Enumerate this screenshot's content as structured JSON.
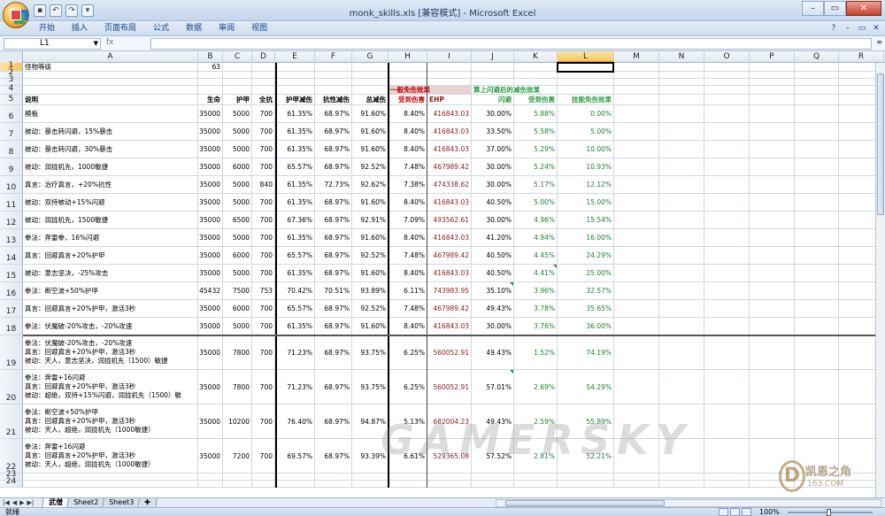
{
  "window": {
    "title": "monk_skills.xls  [兼容模式] - Microsoft Excel",
    "min": "–",
    "restore": "▭",
    "close": "✕"
  },
  "ribbon": {
    "tabs": [
      "开始",
      "插入",
      "页面布局",
      "公式",
      "数据",
      "审阅",
      "视图"
    ]
  },
  "formula_bar": {
    "name_box": "L1",
    "fx": "fx",
    "value": ""
  },
  "columns": [
    "A",
    "B",
    "C",
    "D",
    "E",
    "F",
    "G",
    "H",
    "I",
    "J",
    "K",
    "L",
    "M",
    "N",
    "O",
    "P",
    "Q",
    "R"
  ],
  "selected_column": "L",
  "selected_row": 1,
  "sheet": {
    "r1": {
      "label": "怪物等级",
      "value": "63"
    },
    "r4": {
      "h": "一般免伤效果",
      "j": "算上闪避后的减伤效果"
    },
    "r5": [
      "说明",
      "生命",
      "护甲",
      "全抗",
      "护甲减伤",
      "抗性减伤",
      "总减伤",
      "受到伤害",
      "EHP",
      "闪避",
      "受到伤害",
      "技能免伤效果"
    ],
    "rows": [
      {
        "n": "6",
        "a": "模板",
        "b": "35000",
        "c": "5000",
        "d": "700",
        "e": "61.35%",
        "f": "68.97%",
        "g": "91.60%",
        "h": "8.40%",
        "i": "416843.03",
        "j": "30.00%",
        "k": "5.88%",
        "l": "0.00%"
      },
      {
        "n": "7",
        "a": "被动：暴击转闪避，15%暴击",
        "b": "35000",
        "c": "5000",
        "d": "700",
        "e": "61.35%",
        "f": "68.97%",
        "g": "91.60%",
        "h": "8.40%",
        "i": "416843.03",
        "j": "33.50%",
        "k": "5.58%",
        "l": "5.00%"
      },
      {
        "n": "8",
        "a": "被动：暴击转闪避，30%暴击",
        "b": "35000",
        "c": "5000",
        "d": "700",
        "e": "61.35%",
        "f": "68.97%",
        "g": "91.60%",
        "h": "8.40%",
        "i": "416843.03",
        "j": "37.00%",
        "k": "5.29%",
        "l": "10.00%"
      },
      {
        "n": "9",
        "a": "被动：润拢机先，1000敏捷",
        "b": "35000",
        "c": "6000",
        "d": "700",
        "e": "65.57%",
        "f": "68.97%",
        "g": "92.52%",
        "h": "7.48%",
        "i": "467989.42",
        "j": "30.00%",
        "k": "5.24%",
        "l": "10.93%"
      },
      {
        "n": "10",
        "a": "真言：治疗真言，+20%抗性",
        "b": "35000",
        "c": "5000",
        "d": "840",
        "e": "61.35%",
        "f": "72.73%",
        "g": "92.62%",
        "h": "7.38%",
        "i": "474338.62",
        "j": "30.00%",
        "k": "5.17%",
        "l": "12.12%"
      },
      {
        "n": "11",
        "a": "被动：双持被动+15%闪避",
        "b": "35000",
        "c": "5000",
        "d": "700",
        "e": "61.35%",
        "f": "68.97%",
        "g": "91.60%",
        "h": "8.40%",
        "i": "416843.03",
        "j": "40.50%",
        "k": "5.00%",
        "l": "15.00%"
      },
      {
        "n": "12",
        "a": "被动：润拢机先，1500敏捷",
        "b": "35000",
        "c": "6500",
        "d": "700",
        "e": "67.36%",
        "f": "68.97%",
        "g": "92.91%",
        "h": "7.09%",
        "i": "493562.61",
        "j": "30.00%",
        "k": "4.96%",
        "l": "15.54%"
      },
      {
        "n": "13",
        "a": "拳法：奔雷拳，16%闪避",
        "b": "35000",
        "c": "5000",
        "d": "700",
        "e": "61.35%",
        "f": "68.97%",
        "g": "91.60%",
        "h": "8.40%",
        "i": "416843.03",
        "j": "41.20%",
        "k": "4.94%",
        "l": "16.00%"
      },
      {
        "n": "14",
        "a": "真言：回避真言+20%护甲",
        "b": "35000",
        "c": "6000",
        "d": "700",
        "e": "65.57%",
        "f": "68.97%",
        "g": "92.52%",
        "h": "7.48%",
        "i": "467989.42",
        "j": "40.50%",
        "k": "4.45%",
        "l": "24.29%"
      },
      {
        "n": "15",
        "a": "被动：意志坚决，-25%攻击",
        "b": "35000",
        "c": "5000",
        "d": "700",
        "e": "61.35%",
        "f": "68.97%",
        "g": "91.60%",
        "h": "8.40%",
        "i": "416843.03",
        "j": "40.50%",
        "k": "4.41%",
        "l": "25.00%"
      },
      {
        "n": "16",
        "a": "拳法：断空波+50%护甲",
        "b": "45432",
        "c": "7500",
        "d": "753",
        "e": "70.42%",
        "f": "70.51%",
        "g": "93.89%",
        "h": "6.11%",
        "i": "743983.95",
        "j": "35.10%",
        "k": "3.96%",
        "l": "32.57%"
      },
      {
        "n": "17",
        "a": "真言：回避真言+20%护甲，激活3秒",
        "b": "35000",
        "c": "6000",
        "d": "700",
        "e": "65.57%",
        "f": "68.97%",
        "g": "92.52%",
        "h": "7.48%",
        "i": "467989.42",
        "j": "49.43%",
        "k": "3.78%",
        "l": "35.65%"
      },
      {
        "n": "18",
        "a": "拳法：伏魔破-20%攻击，-20%攻速",
        "b": "35000",
        "c": "5000",
        "d": "700",
        "e": "61.35%",
        "f": "68.97%",
        "g": "91.60%",
        "h": "8.40%",
        "i": "416843.03",
        "j": "30.00%",
        "k": "3.76%",
        "l": "36.00%"
      },
      {
        "n": "19",
        "a": "拳法：伏魔破-20%攻击，-20%攻速\n真言：回避真言+20%护甲，激活3秒\n被动：天人，意志坚决，润拢机先（1500）敏捷",
        "b": "35000",
        "c": "7800",
        "d": "700",
        "e": "71.23%",
        "f": "68.97%",
        "g": "93.75%",
        "h": "6.25%",
        "i": "560052.91",
        "j": "49.43%",
        "k": "1.52%",
        "l": "74.19%"
      },
      {
        "n": "20",
        "a": "拳法：奔雷+16闪避\n真言：回避真言+20%护甲，激活3秒\n被动：超绝，双持+15%闪避，润拢机先（1500）敏",
        "b": "35000",
        "c": "7800",
        "d": "700",
        "e": "71.23%",
        "f": "68.97%",
        "g": "93.75%",
        "h": "6.25%",
        "i": "560052.91",
        "j": "57.01%",
        "k": "2.69%",
        "l": "54.29%"
      },
      {
        "n": "21",
        "a": "拳法：断空波+50%护甲\n真言：回避真言+20%护甲，激活3秒\n被动：天人，超绝，润拢机先（1000敏捷）",
        "b": "35000",
        "c": "10200",
        "d": "700",
        "e": "76.40%",
        "f": "68.97%",
        "g": "94.87%",
        "h": "5.13%",
        "i": "682004.23",
        "j": "49.43%",
        "k": "2.59%",
        "l": "55.89%"
      },
      {
        "n": "22",
        "a": "拳法：奔雷+16闪避\n真言：回避真言+20%护甲，激活3秒\n被动：天人，超绝，润拢机先（1000敏捷）",
        "b": "35000",
        "c": "7200",
        "d": "700",
        "e": "69.57%",
        "f": "68.97%",
        "g": "93.39%",
        "h": "6.61%",
        "i": "529365.08",
        "j": "57.52%",
        "k": "2.81%",
        "l": "52.21%"
      }
    ],
    "empty_rows": [
      "2",
      "3",
      "23",
      "24"
    ]
  },
  "sheet_tabs": [
    "武僧",
    "Sheet2",
    "Sheet3"
  ],
  "active_sheet": "武僧",
  "status": "就绪",
  "zoom": "100%",
  "watermark": "GAMERSKY",
  "logo": {
    "line1": "凯恩之角",
    "line2": "163.COM"
  }
}
